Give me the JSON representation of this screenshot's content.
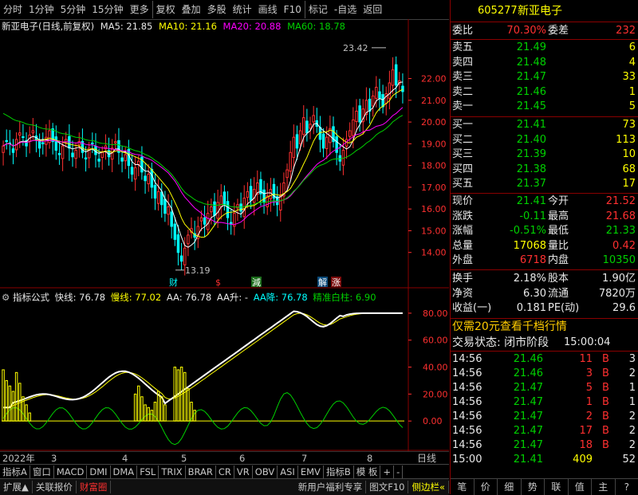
{
  "toolbar": {
    "items": [
      "分时",
      "1分钟",
      "5分钟",
      "15分钟",
      "更多",
      "复权",
      "叠加",
      "多股",
      "统计",
      "画线",
      "F10",
      "标记",
      "-自选",
      "返回"
    ]
  },
  "title": {
    "stock_name": "新亚电子(日线,前复权)",
    "ma5_label": "MA5: 21.85",
    "ma10_label": "MA10: 21.16",
    "ma20_label": "MA20: 20.88",
    "ma60_label": "MA60: 18.78"
  },
  "indicator": {
    "name": "指标公式",
    "fast": "快线: 76.78",
    "slow": "慢线: 77.02",
    "aa": "AA: 76.78",
    "aa_up": "AA升: -",
    "aa_down": "AA降: 76.78",
    "white_bar": "精准白柱: 6.90"
  },
  "markers": {
    "cai": "财",
    "dollar": "$",
    "jian": "減",
    "jie": "解",
    "zhang": "涨"
  },
  "colors": {
    "up": "#ff3030",
    "down": "#00ffff",
    "ma5": "#ffffff",
    "ma10": "#ffff00",
    "ma20": "#ff00ff",
    "ma60": "#00d000",
    "axis": "#ff3030"
  },
  "dates": {
    "year": "2022年",
    "months": [
      "3",
      "4",
      "5",
      "6",
      "7",
      "8"
    ],
    "right_label": "日线"
  },
  "tabs": [
    "指标A",
    "窗口",
    "MACD",
    "DMI",
    "DMA",
    "FSL",
    "TRIX",
    "BRAR",
    "CR",
    "VR",
    "OBV",
    "ASI",
    "EMV",
    "指标B",
    "模 板",
    "+",
    "-"
  ],
  "status": {
    "items": [
      "扩展▲",
      "关联报价",
      "财富圈"
    ],
    "right_items": [
      "新用户福利专享",
      "图文F10",
      "侧边栏«"
    ]
  },
  "quote": {
    "code": "605277",
    "name": "新亚电子",
    "wei_bi_label": "委比",
    "wei_bi": "70.30%",
    "wei_cha_label": "委差",
    "wei_cha": "232",
    "asks": [
      {
        "label": "卖五",
        "price": "21.49",
        "vol": "6"
      },
      {
        "label": "卖四",
        "price": "21.48",
        "vol": "4"
      },
      {
        "label": "卖三",
        "price": "21.47",
        "vol": "33"
      },
      {
        "label": "卖二",
        "price": "21.46",
        "vol": "1"
      },
      {
        "label": "卖一",
        "price": "21.45",
        "vol": "5"
      }
    ],
    "bids": [
      {
        "label": "买一",
        "price": "21.41",
        "vol": "73"
      },
      {
        "label": "买二",
        "price": "21.40",
        "vol": "113"
      },
      {
        "label": "买三",
        "price": "21.39",
        "vol": "10"
      },
      {
        "label": "买四",
        "price": "21.38",
        "vol": "68"
      },
      {
        "label": "买五",
        "price": "21.37",
        "vol": "17"
      }
    ],
    "stats1": [
      {
        "l1": "现价",
        "v1": "21.41",
        "l2": "今开",
        "v2": "21.52"
      },
      {
        "l1": "涨跌",
        "v1": "-0.11",
        "l2": "最高",
        "v2": "21.68"
      },
      {
        "l1": "涨幅",
        "v1": "-0.51%",
        "l2": "最低",
        "v2": "21.33"
      },
      {
        "l1": "总量",
        "v1": "17068",
        "l2": "量比",
        "v2": "0.42"
      },
      {
        "l1": "外盘",
        "v1": "6718",
        "l2": "内盘",
        "v2": "10350"
      }
    ],
    "stats2": [
      {
        "l1": "换手",
        "v1": "2.18%",
        "l2": "股本",
        "v2": "1.90亿"
      },
      {
        "l1": "净资",
        "v1": "6.30",
        "l2": "流通",
        "v2": "7820万"
      },
      {
        "l1": "收益(一)",
        "v1": "0.181",
        "l2": "PE(动)",
        "v2": "29.6"
      }
    ],
    "promo": "仅需20元查看千档行情",
    "trade_state_label": "交易状态: 闭市阶段",
    "trade_state_time": "15:00:04",
    "ticks": [
      {
        "time": "14:56",
        "price": "21.46",
        "vol": "11",
        "bs": "B",
        "n": "3"
      },
      {
        "time": "14:56",
        "price": "21.46",
        "vol": "3",
        "bs": "B",
        "n": "2"
      },
      {
        "time": "14:56",
        "price": "21.47",
        "vol": "5",
        "bs": "B",
        "n": "1"
      },
      {
        "time": "14:56",
        "price": "21.47",
        "vol": "1",
        "bs": "B",
        "n": "1"
      },
      {
        "time": "14:56",
        "price": "21.47",
        "vol": "2",
        "bs": "B",
        "n": "2"
      },
      {
        "time": "14:56",
        "price": "21.47",
        "vol": "17",
        "bs": "B",
        "n": "2"
      },
      {
        "time": "14:56",
        "price": "21.47",
        "vol": "18",
        "bs": "B",
        "n": "2"
      },
      {
        "time": "15:00",
        "price": "21.41",
        "vol": "409",
        "bs": "",
        "n": "52"
      }
    ],
    "bottom_tabs": [
      "笔",
      "价",
      "细",
      "势",
      "联",
      "值",
      "主",
      "?"
    ]
  },
  "chart_data": [
    {
      "type": "candlestick",
      "ylim": [
        13.0,
        24.0
      ],
      "y_ticks": [
        14.0,
        15.0,
        16.0,
        17.0,
        18.0,
        19.0,
        20.0,
        21.0,
        22.0
      ],
      "high_label": "23.42",
      "low_label": "13.19",
      "x_month_labels": [
        "2022年",
        "3",
        "4",
        "5",
        "6",
        "7",
        "8"
      ],
      "closes": [
        18.9,
        19.1,
        19.0,
        18.6,
        19.2,
        19.5,
        19.3,
        18.9,
        19.4,
        19.6,
        19.2,
        18.8,
        19.0,
        19.3,
        19.6,
        19.1,
        18.7,
        18.5,
        18.9,
        19.2,
        18.8,
        18.4,
        18.7,
        19.1,
        18.6,
        18.3,
        18.8,
        19.0,
        18.5,
        18.2,
        18.6,
        18.9,
        18.4,
        18.8,
        19.1,
        18.6,
        18.2,
        18.5,
        18.0,
        17.6,
        17.9,
        18.2,
        17.7,
        17.3,
        17.6,
        17.0,
        16.5,
        16.8,
        16.2,
        15.8,
        16.1,
        15.2,
        14.6,
        14.0,
        13.6,
        14.2,
        14.8,
        15.1,
        14.7,
        15.2,
        15.6,
        15.3,
        15.8,
        16.1,
        15.7,
        16.3,
        16.6,
        16.2,
        15.6,
        15.3,
        15.8,
        16.2,
        15.9,
        16.5,
        16.8,
        16.4,
        16.9,
        17.2,
        16.7,
        16.3,
        16.6,
        16.9,
        16.5,
        16.2,
        16.6,
        17.2,
        17.8,
        18.6,
        19.3,
        18.8,
        19.6,
        20.2,
        19.5,
        19.9,
        20.3,
        19.8,
        19.2,
        18.8,
        19.3,
        19.7,
        19.1,
        18.6,
        18.2,
        18.7,
        19.2,
        19.6,
        20.1,
        20.5,
        20.0,
        20.6,
        21.0,
        20.5,
        21.2,
        21.6,
        21.1,
        20.7,
        21.3,
        21.8,
        22.4,
        21.7,
        21.9,
        21.4
      ],
      "ma5_label": "MA5: 21.85",
      "ma10_label": "MA10: 21.16",
      "ma20_label": "MA20: 20.88",
      "ma60_label": "MA60: 18.78"
    },
    {
      "type": "line",
      "ylim": [
        -20,
        90
      ],
      "y_ticks": [
        0.0,
        20.0,
        40.0,
        60.0,
        80.0
      ],
      "series": [
        {
          "name": "快线",
          "last": 76.78
        },
        {
          "name": "慢线",
          "last": 77.02
        },
        {
          "name": "AA",
          "last": 76.78
        },
        {
          "name": "精准白柱",
          "last": 6.9
        }
      ]
    }
  ]
}
